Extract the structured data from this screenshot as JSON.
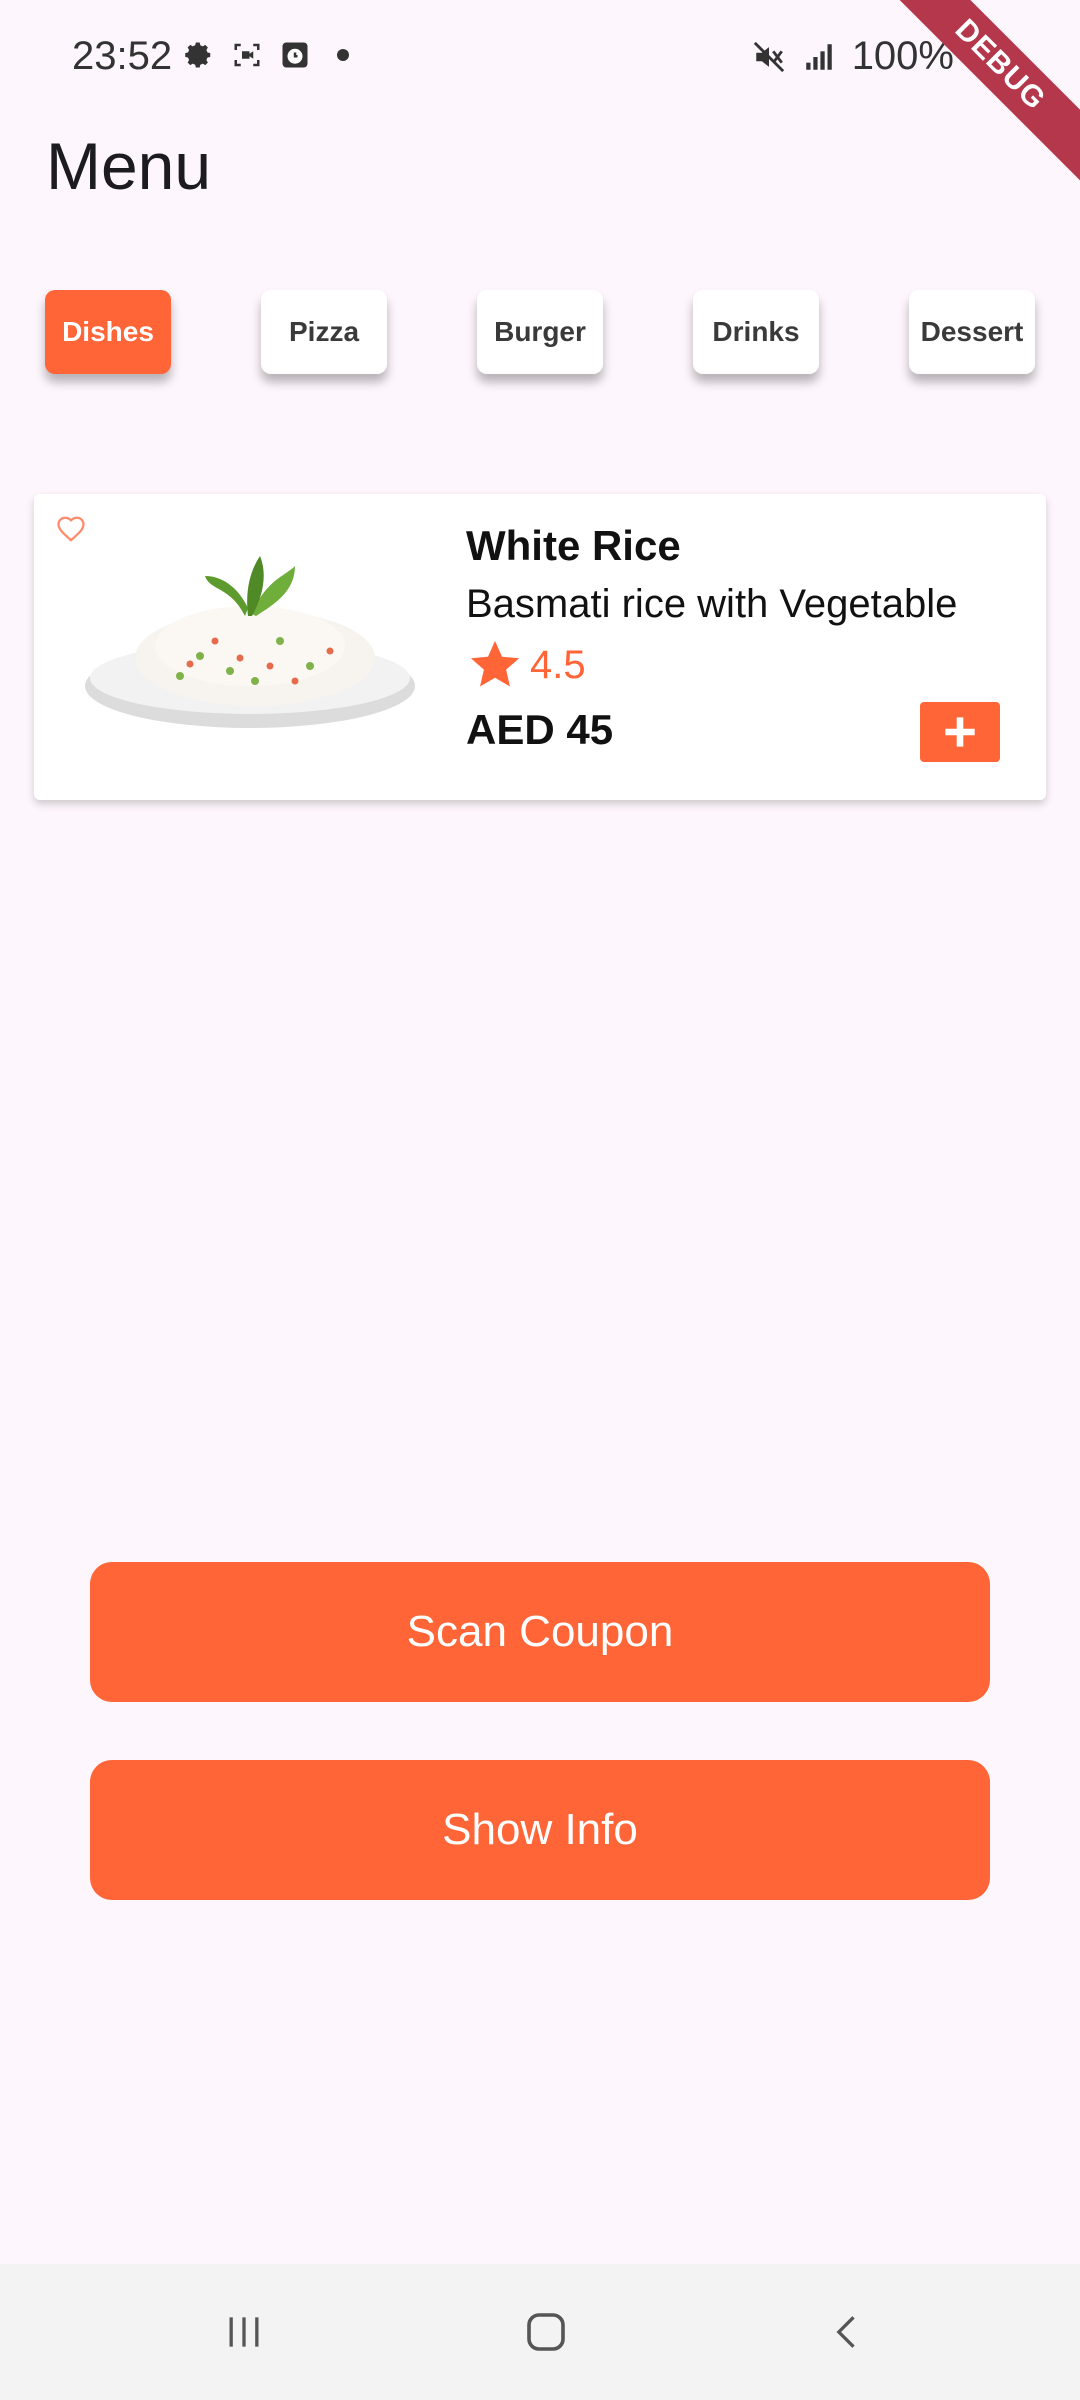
{
  "status_bar": {
    "time": "23:52",
    "battery": "100%",
    "left_icons": [
      "settings-icon",
      "screen-record-icon",
      "clock-app-icon",
      "dot-icon"
    ],
    "right_icons": [
      "mute-icon",
      "signal-icon",
      "battery-charging-icon"
    ]
  },
  "debug_banner": "DEBUG",
  "page": {
    "title": "Menu"
  },
  "categories": [
    {
      "label": "Dishes",
      "active": true
    },
    {
      "label": "Pizza",
      "active": false
    },
    {
      "label": "Burger",
      "active": false
    },
    {
      "label": "Drinks",
      "active": false
    },
    {
      "label": "Dessert",
      "active": false
    }
  ],
  "menu_item": {
    "name": "White Rice",
    "description": "Basmati rice with Vegetable",
    "rating": "4.5",
    "price": "AED 45",
    "image": "white-rice-plate-image",
    "favorite_icon": "heart-outline-icon",
    "add_icon": "plus-icon"
  },
  "buttons": {
    "scan_coupon": "Scan Coupon",
    "show_info": "Show Info"
  },
  "nav_bar": [
    "recent-apps-icon",
    "home-icon",
    "back-icon"
  ],
  "colors": {
    "accent": "#ff6537",
    "background": "#fdf6fc",
    "debug_ribbon": "#b5374b"
  }
}
